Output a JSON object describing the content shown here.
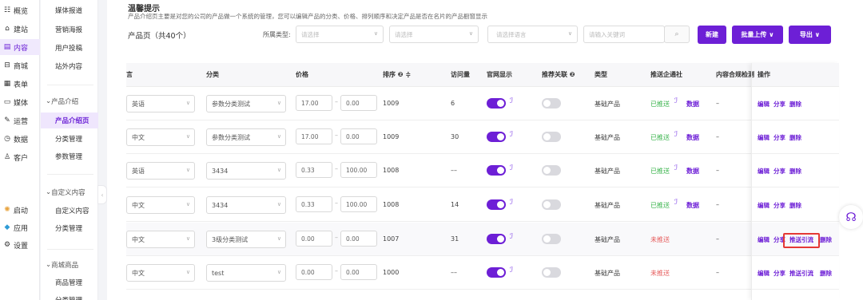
{
  "nav": {
    "items": [
      {
        "icon": "☷",
        "label": "概览"
      },
      {
        "icon": "⌂",
        "label": "建站"
      },
      {
        "icon": "▤",
        "label": "内容"
      },
      {
        "icon": "⊟",
        "label": "商城"
      },
      {
        "icon": "▦",
        "label": "表单"
      },
      {
        "icon": "▭",
        "label": "媒体"
      },
      {
        "icon": "✎",
        "label": "运营"
      },
      {
        "icon": "◷",
        "label": "数据"
      },
      {
        "icon": "♙",
        "label": "客户"
      },
      {
        "icon": "✺",
        "label": "启动"
      },
      {
        "icon": "◆",
        "label": "应用"
      },
      {
        "icon": "⚙",
        "label": "设置"
      }
    ]
  },
  "subnav": {
    "top_items": [
      "媒体报道",
      "营销海报",
      "用户投稿",
      "站外内容"
    ],
    "group1": {
      "label": "产品介绍",
      "items": [
        "产品介绍页",
        "分类管理",
        "参数管理"
      ]
    },
    "group2": {
      "label": "自定义内容",
      "items": [
        "自定义内容",
        "分类管理"
      ]
    },
    "group3": {
      "label": "商城商品",
      "items": [
        "商品管理",
        "分类管理"
      ]
    }
  },
  "notice": {
    "title": "温馨提示",
    "text": "产品介绍页主要是对您的公司的产品做一个系统的管理，您可以编辑产品的分类、价格、排列顺序和决定产品是否在名片的产品橱窗显示"
  },
  "page_title": "产品页（共40个）",
  "filters": {
    "type_label": "所属类型:",
    "select1": "请选择",
    "select2": "请选择",
    "select3": "请选择语言",
    "search_placeholder": "请输入关键词"
  },
  "buttons": {
    "new": "新建",
    "batch_upload": "批量上传 ∨",
    "export": "导出 ∨"
  },
  "table": {
    "headers": {
      "lang": "言",
      "category": "分类",
      "price": "价格",
      "sort": "排序 ❷ ≑",
      "visits": "访问量",
      "site": "官网显示",
      "recommend": "推荐关联 ❷",
      "type": "类型",
      "push": "推送企通社",
      "compliance": "内容合规检测",
      "ops": "操作"
    },
    "rows": [
      {
        "lang": "英语",
        "category": "参数分类测试",
        "p1": "17.00",
        "p2": "0.00",
        "sort": "1009",
        "visits": "6",
        "type": "基础产品",
        "push": "已推送",
        "pushed": true,
        "data": "数据",
        "compliance": "–",
        "ops": [
          "编辑",
          "分享",
          "删除"
        ]
      },
      {
        "lang": "中文",
        "category": "参数分类测试",
        "p1": "17.00",
        "p2": "0.00",
        "sort": "1009",
        "visits": "30",
        "type": "基础产品",
        "push": "已推送",
        "pushed": true,
        "data": "数据",
        "compliance": "–",
        "ops": [
          "编辑",
          "分享",
          "删除"
        ]
      },
      {
        "lang": "英语",
        "category": "3434",
        "p1": "0.33",
        "p2": "100.00",
        "sort": "1008",
        "visits": "––",
        "type": "基础产品",
        "push": "已推送",
        "pushed": true,
        "data": "数据",
        "compliance": "–",
        "ops": [
          "编辑",
          "分享",
          "删除"
        ]
      },
      {
        "lang": "中文",
        "category": "3434",
        "p1": "0.33",
        "p2": "100.00",
        "sort": "1008",
        "visits": "14",
        "type": "基础产品",
        "push": "已推送",
        "pushed": true,
        "data": "数据",
        "compliance": "–",
        "ops": [
          "编辑",
          "分享",
          "删除"
        ]
      },
      {
        "lang": "中文",
        "category": "3级分类测试",
        "p1": "0.00",
        "p2": "0.00",
        "sort": "1007",
        "visits": "31",
        "type": "基础产品",
        "push": "未推送",
        "pushed": false,
        "data": "",
        "compliance": "–",
        "ops": [
          "编辑",
          "分享",
          "推送引流",
          "删除"
        ]
      },
      {
        "lang": "中文",
        "category": "test",
        "p1": "0.00",
        "p2": "0.00",
        "sort": "1000",
        "visits": "––",
        "type": "基础产品",
        "push": "未推送",
        "pushed": false,
        "data": "",
        "compliance": "–",
        "ops": [
          "编辑",
          "分享",
          "推送引流",
          "删除"
        ]
      }
    ]
  }
}
